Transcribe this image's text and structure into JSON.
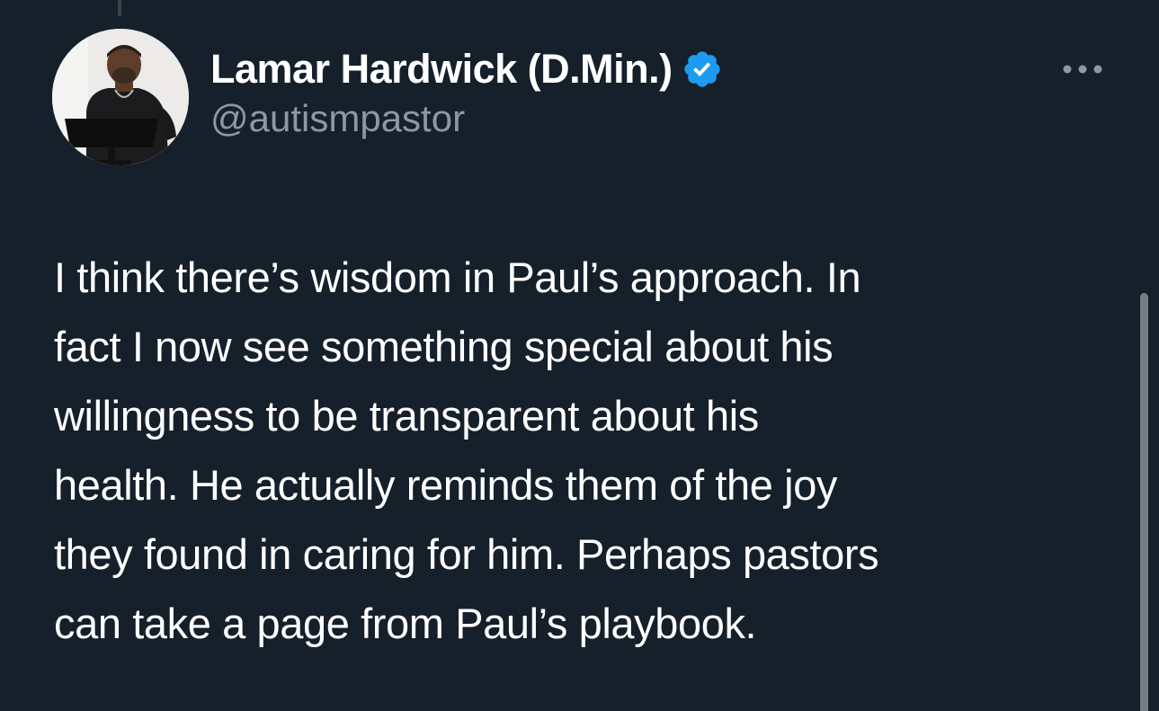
{
  "author": {
    "display_name": "Lamar Hardwick (D.Min.)",
    "handle": "@autismpastor",
    "verified": true
  },
  "icons": {
    "verified": "verified-badge-icon",
    "more": "more-horizontal-icon"
  },
  "tweet": {
    "lines": [
      "I think there’s wisdom in Paul’s approach. In",
      "fact I now see something special about his",
      "willingness to be transparent about his",
      "health. He actually reminds them of the joy",
      "they found in caring for him. Perhaps pastors",
      "can take a page from Paul’s playbook."
    ]
  },
  "colors": {
    "background": "#15202b",
    "text_primary": "#ffffff",
    "text_secondary": "#8b98a5",
    "verified_blue": "#1d9bf0"
  }
}
